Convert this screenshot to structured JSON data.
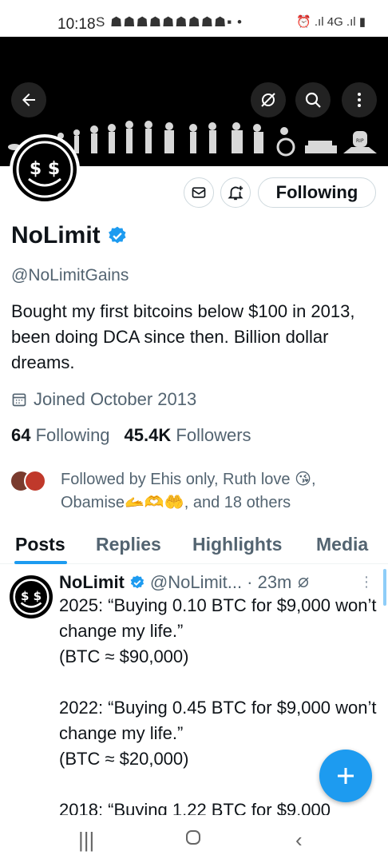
{
  "status_bar": {
    "time": "10:18",
    "left_icons": "S ☗☗☗☗☗☗☗☗☗▪ •",
    "right_icons": "⏰ .ıl 4G .ıl ▮"
  },
  "banner": {
    "caption": "RIP"
  },
  "profile": {
    "display_name": "NoLimit",
    "handle": "@NoLimitGains",
    "bio": "Bought my first bitcoins below $100 in 2013, been doing DCA since then. Billion dollar dreams.",
    "joined": "Joined October 2013",
    "following_count": "64",
    "following_label": "Following",
    "followers_count": "45.4K",
    "followers_label": "Followers",
    "follow_button": "Following",
    "followed_by": "Followed by Ehis only, Ruth love 😘, Obamise🫴🫶🤲, and 18 others",
    "avatar_text": "$ $"
  },
  "tabs": [
    {
      "label": "Posts"
    },
    {
      "label": "Replies"
    },
    {
      "label": "Highlights"
    },
    {
      "label": "Media"
    }
  ],
  "post": {
    "name": "NoLimit",
    "handle": "@NoLimit...",
    "time": "· 23m",
    "body": "2025: “Buying 0.10 BTC for $9,000 won’t change my life.”\n(BTC ≈ $90,000)\n\n2022: “Buying 0.45 BTC for $9,000 won’t change my life.”\n(BTC ≈ $20,000)\n\n2018: “Buying 1.22 BTC for $9,000"
  },
  "colors": {
    "accent": "#1d9bf0",
    "secondary_text": "#536471",
    "text": "#0f1419"
  },
  "icons": {
    "back": "arrow-left-icon",
    "grok": "grok-icon",
    "search": "search-icon",
    "more": "more-vertical-icon",
    "message": "mail-icon",
    "notify": "bell-plus-icon",
    "verified": "verified-badge-icon",
    "calendar": "calendar-icon",
    "compose": "plus-icon"
  }
}
